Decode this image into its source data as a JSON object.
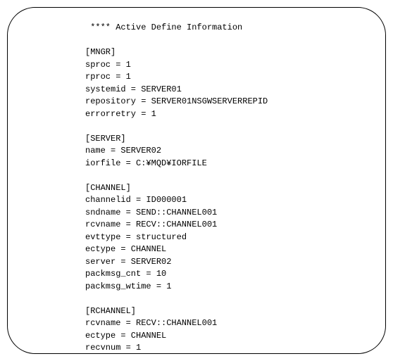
{
  "lines": [
    " **** Active Define Information",
    "",
    "[MNGR]",
    "sproc = 1",
    "rproc = 1",
    "systemid = SERVER01",
    "repository = SERVER01NSGWSERVERREPID",
    "errorretry = 1",
    "",
    "[SERVER]",
    "name = SERVER02",
    "iorfile = C:¥MQD¥IORFILE",
    "",
    "[CHANNEL]",
    "channelid = ID000001",
    "sndname = SEND::CHANNEL001",
    "rcvname = RECV::CHANNEL001",
    "evttype = structured",
    "ectype = CHANNEL",
    "server = SERVER02",
    "packmsg_cnt = 10",
    "packmsg_wtime = 1",
    "",
    "[RCHANNEL]",
    "rcvname = RECV::CHANNEL001",
    "ectype = CHANNEL",
    "recvnum = 1"
  ]
}
